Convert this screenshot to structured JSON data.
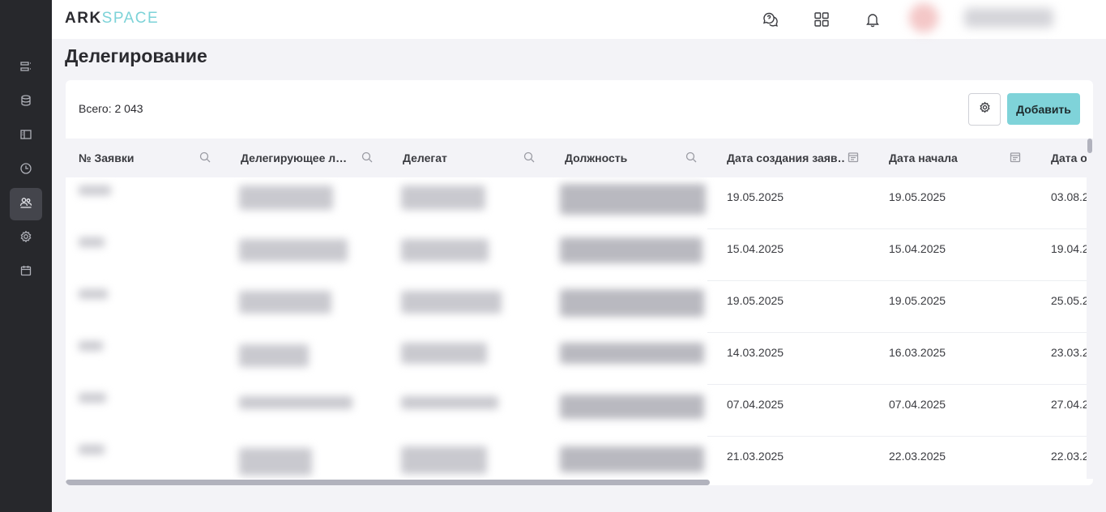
{
  "app": {
    "logo_primary": "ARK",
    "logo_secondary": "SPACE"
  },
  "sidebar": {
    "items": [
      {
        "icon": "list-icon",
        "active": false
      },
      {
        "icon": "database-icon",
        "active": false
      },
      {
        "icon": "book-icon",
        "active": false
      },
      {
        "icon": "clock-icon",
        "active": false
      },
      {
        "icon": "users-icon",
        "active": true
      },
      {
        "icon": "gear-icon",
        "active": false
      },
      {
        "icon": "calendar-icon",
        "active": false
      }
    ]
  },
  "topbar": {
    "icons": [
      "chat-icon",
      "apps-grid-icon",
      "bell-icon"
    ]
  },
  "page": {
    "title": "Делегирование"
  },
  "toolbar": {
    "total_label": "Всего: 2 043",
    "add_label": "Добавить"
  },
  "table": {
    "columns": [
      {
        "label": "№ Заявки",
        "icon": "search-icon"
      },
      {
        "label": "Делегирующее л…",
        "icon": "search-icon"
      },
      {
        "label": "Делегат",
        "icon": "search-icon"
      },
      {
        "label": "Должность",
        "icon": "search-icon"
      },
      {
        "label": "Дата создания заяв…",
        "icon": "calendar-icon"
      },
      {
        "label": "Дата начала",
        "icon": "calendar-icon"
      },
      {
        "label": "Дата о",
        "icon": ""
      }
    ],
    "rows": [
      {
        "created": "19.05.2025",
        "start": "19.05.2025",
        "end": "03.08.2"
      },
      {
        "created": "15.04.2025",
        "start": "15.04.2025",
        "end": "19.04.2"
      },
      {
        "created": "19.05.2025",
        "start": "19.05.2025",
        "end": "25.05.2"
      },
      {
        "created": "14.03.2025",
        "start": "16.03.2025",
        "end": "23.03.2"
      },
      {
        "created": "07.04.2025",
        "start": "07.04.2025",
        "end": "27.04.2"
      },
      {
        "created": "21.03.2025",
        "start": "22.03.2025",
        "end": "22.03.2"
      }
    ]
  }
}
